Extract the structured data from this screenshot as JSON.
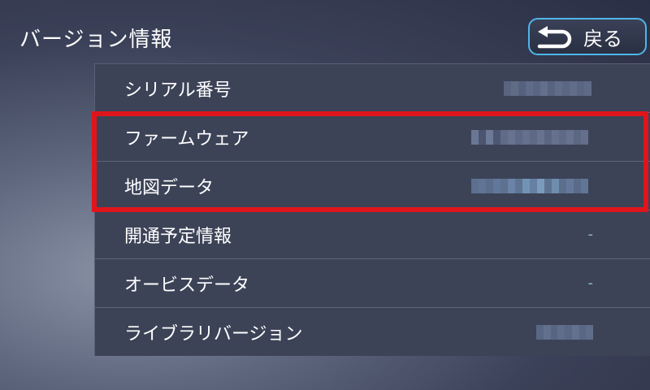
{
  "header": {
    "title": "バージョン情報"
  },
  "back_button": {
    "label": "戻る",
    "icon": "u-turn-back-arrow-icon"
  },
  "rows": [
    {
      "label": "シリアル番号",
      "value": "",
      "value_obscured": true
    },
    {
      "label": "ファームウェア",
      "value": "",
      "value_obscured": true
    },
    {
      "label": "地図データ",
      "value": "",
      "value_obscured": true
    },
    {
      "label": "開通予定情報",
      "value": "-"
    },
    {
      "label": "オービスデータ",
      "value": "-"
    },
    {
      "label": "ライブラリバージョン",
      "value": "",
      "value_obscured": true
    }
  ],
  "colors": {
    "accent": "#4fb6e8",
    "highlight": "#e0151c",
    "panel": "#3c4357",
    "value_text": "#8fb9d6"
  }
}
